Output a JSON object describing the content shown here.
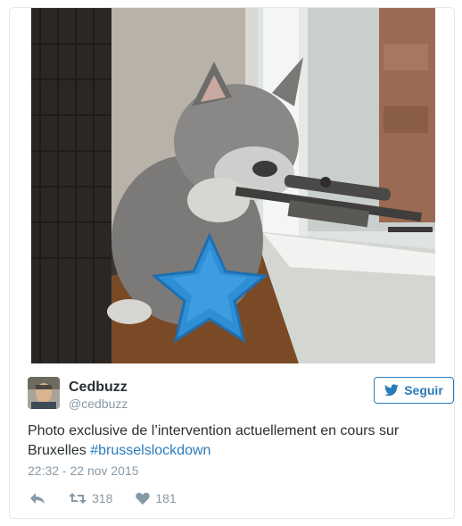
{
  "media": {
    "alt_icon": "kitten-with-rifle-photo"
  },
  "author": {
    "name": "Cedbuzz",
    "handle": "@cedbuzz",
    "avatar_icon": "user-avatar"
  },
  "follow": {
    "label": "Seguir",
    "icon": "twitter-bird-icon"
  },
  "tweet": {
    "text_plain": "Photo exclusive de l’intervention actuellement en cours sur Bruxelles ",
    "hashtag": "#brusselslockdown",
    "timestamp": "22:32 - 22 nov 2015"
  },
  "actions": {
    "reply_icon": "reply-icon",
    "retweet_icon": "retweet-icon",
    "retweet_count": "318",
    "like_icon": "heart-icon",
    "like_count": "181"
  },
  "colors": {
    "accent": "#2b7bb9",
    "text": "#292f33",
    "muted": "#8899a6",
    "border": "#e1e8ed"
  }
}
